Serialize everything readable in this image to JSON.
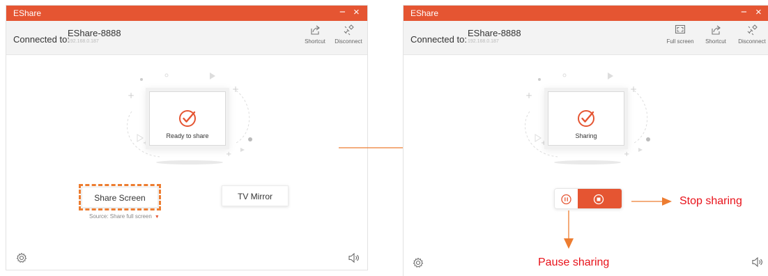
{
  "colors": {
    "accent": "#e55532",
    "annotation": "#ed7d31",
    "annotation_text": "#e8121a"
  },
  "left_window": {
    "title": "EShare",
    "connected_label": "Connected to:",
    "device_name": "EShare-8888",
    "device_ip": "192.168.0.187",
    "toolbar": [
      {
        "label": "Shortcut",
        "icon": "shortcut-icon"
      },
      {
        "label": "Disconnect",
        "icon": "disconnect-icon"
      }
    ],
    "status_text": "Ready to share",
    "share_button": "Share Screen",
    "mirror_button": "TV Mirror",
    "source_text": "Source:  Share full screen"
  },
  "right_window": {
    "title": "EShare",
    "connected_label": "Connected to:",
    "device_name": "EShare-8888",
    "device_ip": "192.168.0.187",
    "toolbar": [
      {
        "label": "Full screen",
        "icon": "full-screen-icon"
      },
      {
        "label": "Shortcut",
        "icon": "shortcut-icon"
      },
      {
        "label": "Disconnect",
        "icon": "disconnect-icon"
      }
    ],
    "status_text": "Sharing"
  },
  "annotations": {
    "stop": "Stop sharing",
    "pause": "Pause sharing"
  }
}
